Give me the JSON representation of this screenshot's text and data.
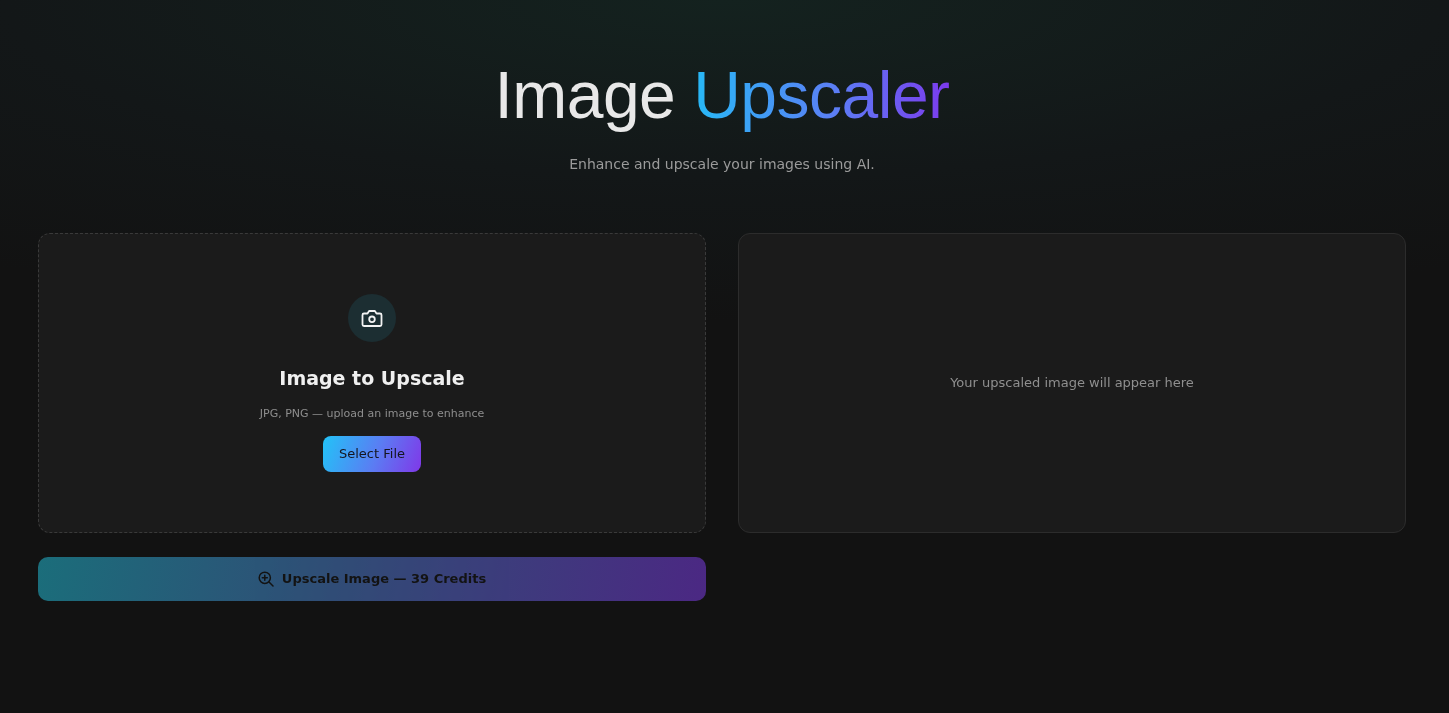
{
  "header": {
    "title": {
      "plain": "Image",
      "highlight": "Upscaler"
    },
    "subtitle": "Enhance and upscale your images using AI."
  },
  "upload_panel": {
    "heading": "Image to Upscale",
    "hint": "JPG, PNG — upload an image to enhance",
    "button": "Select File"
  },
  "upscale_button": {
    "label": "Upscale Image — 39 Credits",
    "disabled": true
  },
  "result_panel": {
    "message": "Your upscaled image will appear here"
  }
}
